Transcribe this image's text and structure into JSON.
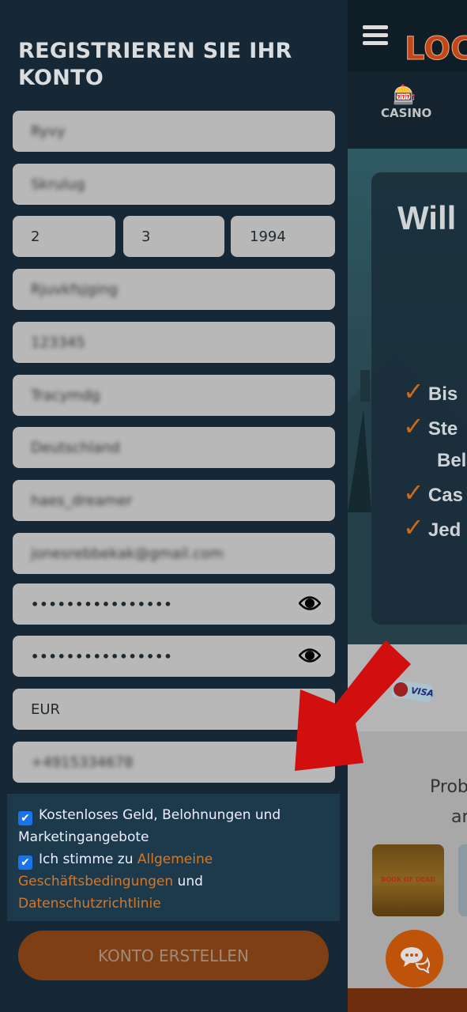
{
  "form": {
    "title": "REGISTRIEREN SIE IHR KONTO",
    "first_name": "Ryvy",
    "last_name": "Skrulug",
    "dob_day": "2",
    "dob_month": "3",
    "dob_year": "1994",
    "address": "Rjuvkfsjging",
    "postcode": "123345",
    "city": "Tracymdg",
    "country": "Deutschland",
    "username": "haes_dreamer",
    "email": "jonesrebbekak@gmail.com",
    "password": "••••••••••••••••",
    "password_confirm": "••••••••••••••••",
    "currency": "EUR",
    "phone": "+4915334678",
    "checkbox_marketing": "Kostenloses Geld, Belohnungen und Marketingangebote",
    "checkbox_terms_prefix": "Ich stimme zu ",
    "terms_link": "Allgemeine Geschäftsbedingungen",
    "terms_and": " und ",
    "privacy_link": "Datenschutzrichtlinie",
    "submit": "KONTO ERSTELLEN"
  },
  "background": {
    "logo": "LOC",
    "nav_casino": "CASINO",
    "hero_title": "Will",
    "bullets": [
      "Bis",
      "Ste",
      "Bel",
      "Cas",
      "Jed"
    ],
    "visa": "VISA",
    "games_heading_1": "Prob",
    "games_heading_2": "ar",
    "game_title": "BOOK OF DEAD"
  },
  "colors": {
    "accent": "#d9771f",
    "button": "#7f3f15",
    "arrow": "#d10f0f",
    "checkbox": "#1a73e8"
  }
}
